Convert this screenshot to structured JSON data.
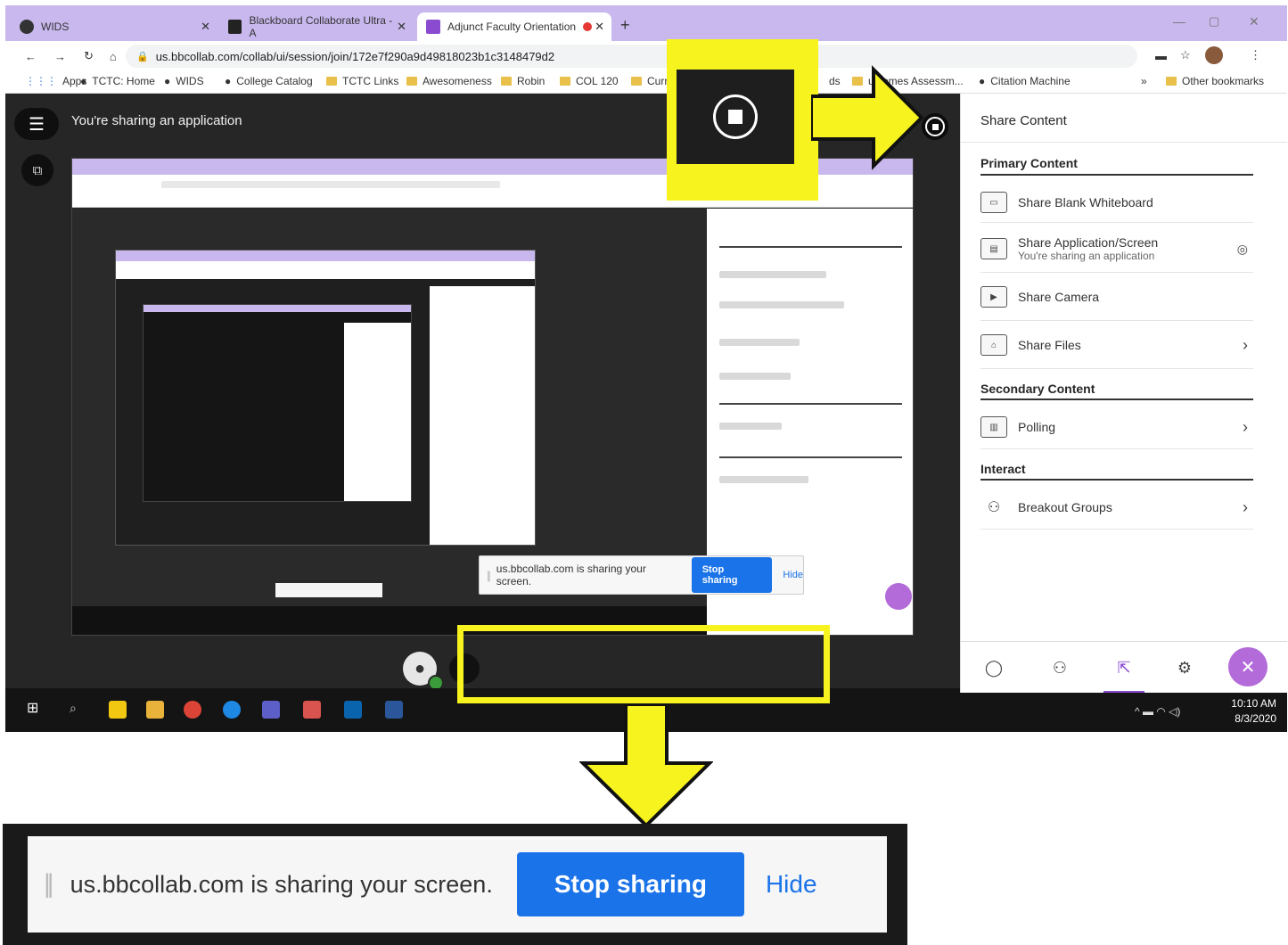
{
  "browser": {
    "tabs": [
      {
        "title": "WIDS"
      },
      {
        "title": "Blackboard Collaborate Ultra - A"
      },
      {
        "title": "Adjunct Faculty Orientation"
      }
    ],
    "new_tab": "+",
    "url": "us.bbcollab.com/collab/ui/session/join/172e7f290a9d49818023b1c3148479d2",
    "bookmarks": [
      {
        "label": "Apps"
      },
      {
        "label": "TCTC: Home"
      },
      {
        "label": "WIDS"
      },
      {
        "label": "College Catalog"
      },
      {
        "label": "TCTC Links"
      },
      {
        "label": "Awesomeness"
      },
      {
        "label": "Robin"
      },
      {
        "label": "COL 120"
      },
      {
        "label": "Curri"
      },
      {
        "label": "ds"
      },
      {
        "label": "utcomes Assessm..."
      },
      {
        "label": "Citation Machine"
      },
      {
        "label": "»"
      },
      {
        "label": "Other bookmarks"
      }
    ]
  },
  "collab": {
    "sharing_label": "You're sharing an application"
  },
  "panel": {
    "title": "Share Content",
    "primary_heading": "Primary Content",
    "whiteboard": "Share Blank Whiteboard",
    "app_screen": "Share Application/Screen",
    "app_screen_sub": "You're sharing an application",
    "camera": "Share Camera",
    "files": "Share Files",
    "secondary_heading": "Secondary Content",
    "polling": "Polling",
    "interact_heading": "Interact",
    "breakout": "Breakout Groups"
  },
  "share_bar": {
    "message": "us.bbcollab.com is sharing your screen.",
    "stop": "Stop sharing",
    "hide": "Hide"
  },
  "taskbar": {
    "time": "10:10 AM",
    "date": "8/3/2020"
  },
  "colors": {
    "highlight": "#f7f31f",
    "accent": "#1a73e8",
    "tab_bar": "#c9b8ee",
    "collab_bg": "#262626",
    "close_fab": "#b36bd9"
  }
}
